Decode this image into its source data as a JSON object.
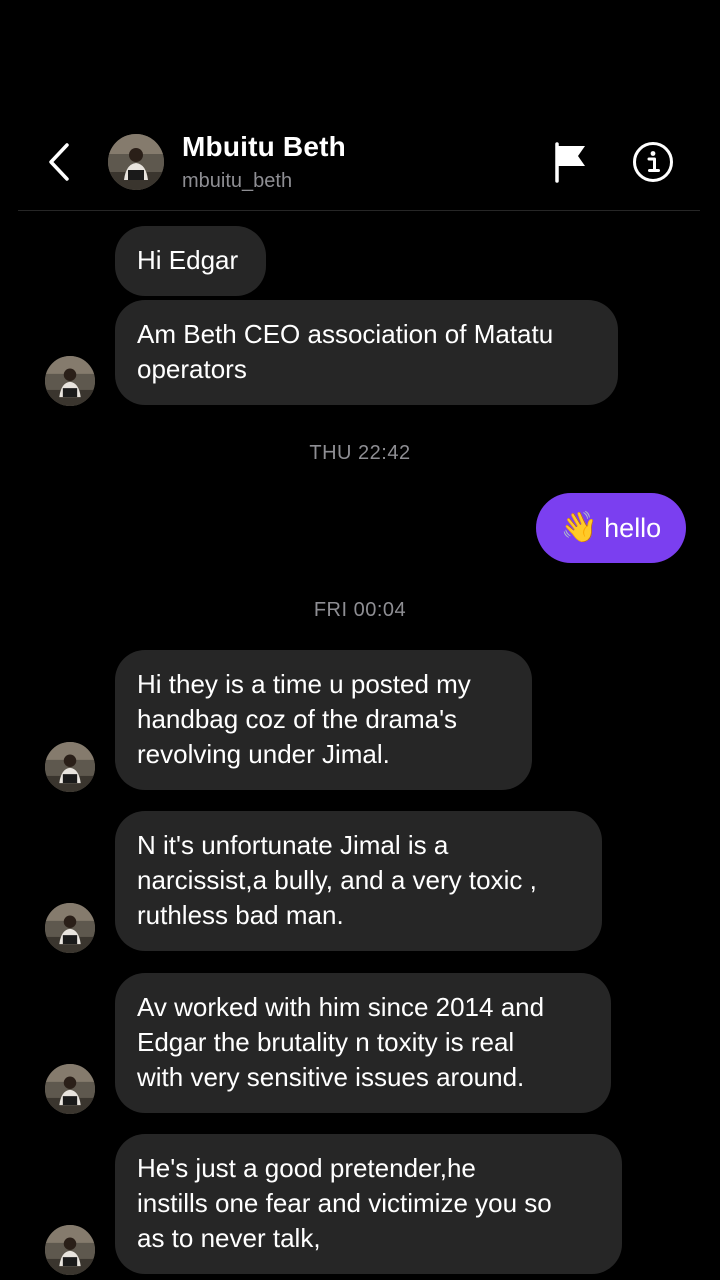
{
  "header": {
    "name": "Mbuitu Beth",
    "username": "mbuitu_beth",
    "icons": {
      "back": "chevron-left-icon",
      "report": "flag-icon",
      "info": "info-circle-icon"
    }
  },
  "colors": {
    "background": "#000000",
    "received_bubble": "#262626",
    "sent_bubble": "#7b3ff0",
    "secondary_text": "#8e8e93"
  },
  "messages": {
    "m1": {
      "lines": [
        "Hi Edgar"
      ]
    },
    "m2": {
      "lines": [
        "Am Beth CEO association of Matatu",
        "operators"
      ]
    },
    "t1": "THU 22:42",
    "sent": {
      "emoji": "👋",
      "text": "hello"
    },
    "t2": "FRI 00:04",
    "m3": {
      "lines": [
        "Hi they is a time u posted my",
        "handbag coz of the drama's",
        "revolving under Jimal."
      ]
    },
    "m4": {
      "lines": [
        "N it's unfortunate Jimal is a",
        "narcissist,a bully, and a very toxic ,",
        "ruthless bad man."
      ]
    },
    "m5": {
      "lines": [
        "Av worked with him since 2014 and",
        "Edgar the brutality n toxity is real",
        "with very sensitive issues around."
      ]
    },
    "m6": {
      "lines": [
        "He's just a good pretender,he",
        "instills one fear and victimize you so",
        "as to never talk,"
      ]
    }
  }
}
